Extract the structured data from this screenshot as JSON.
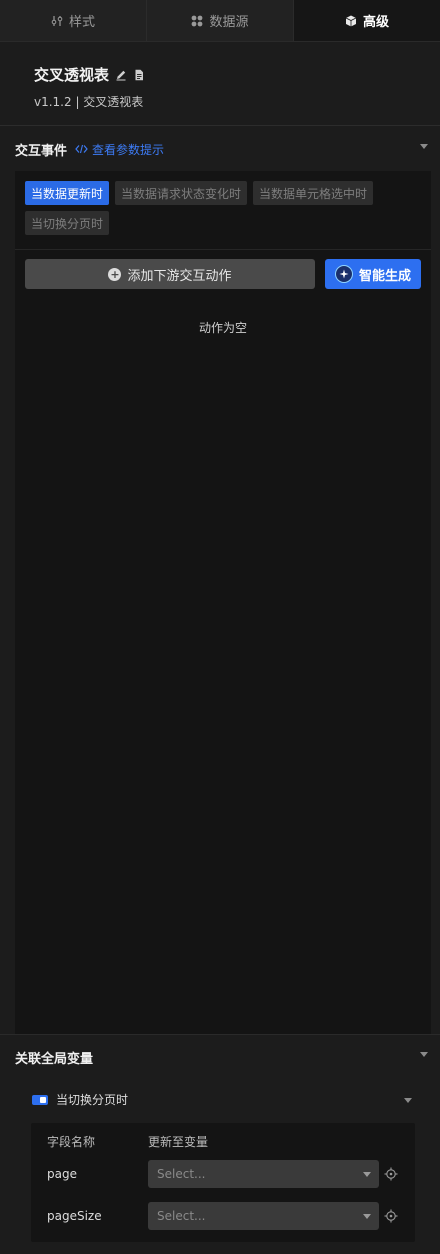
{
  "tabs": [
    {
      "label": "样式",
      "icon": "sliders-icon"
    },
    {
      "label": "数据源",
      "icon": "datasource-icon"
    },
    {
      "label": "高级",
      "icon": "cube-icon"
    }
  ],
  "component": {
    "title": "交叉透视表",
    "version": "v1.1.2 | 交叉透视表"
  },
  "events": {
    "section_title": "交互事件",
    "param_hint_link": "查看参数提示",
    "tags": [
      "当数据更新时",
      "当数据请求状态变化时",
      "当数据单元格选中时",
      "当切换分页时"
    ],
    "active_tag": "当数据更新时",
    "add_action_button": "添加下游交互动作",
    "ai_generate_button": "智能生成",
    "empty_text": "动作为空"
  },
  "global_vars": {
    "section_title": "关联全局变量",
    "event_name": "当切换分页时",
    "col_field": "字段名称",
    "col_var": "更新至变量",
    "rows": [
      {
        "field": "page",
        "placeholder": "Select..."
      },
      {
        "field": "pageSize",
        "placeholder": "Select..."
      }
    ]
  },
  "colors": {
    "accent": "#2d6ff0",
    "link": "#3d7bf5",
    "background": "#1c1c1c"
  }
}
